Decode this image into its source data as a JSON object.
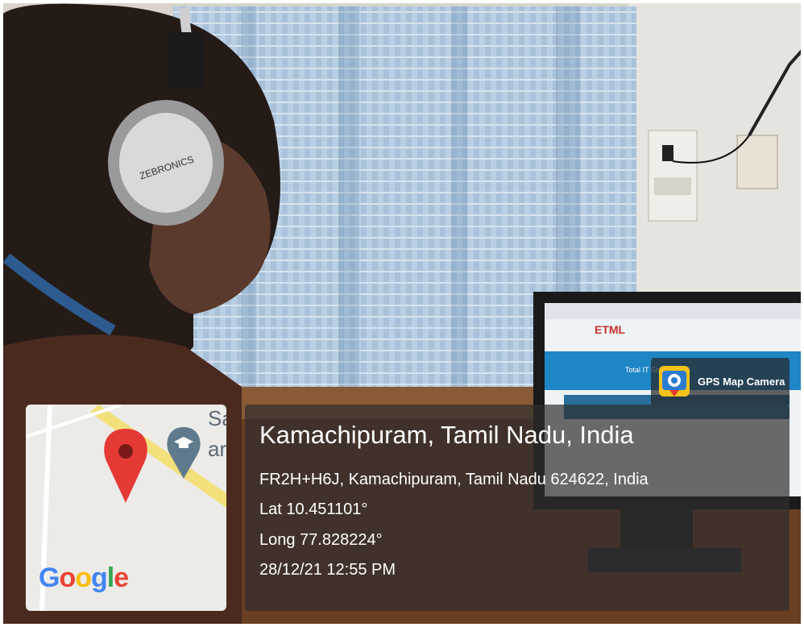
{
  "overlay": {
    "place_title": "Kamachipuram, Tamil Nadu, India",
    "address": "FR2H+H6J, Kamachipuram, Tamil Nadu 624622, India",
    "latitude": "Lat 10.451101°",
    "longitude": "Long 77.828224°",
    "timestamp": "28/12/21 12:55 PM"
  },
  "badge": {
    "app_name": "GPS Map Camera",
    "icon": "gps-camera-icon"
  },
  "map": {
    "place_fragment_1": "Sa",
    "place_fragment_2": "ar",
    "attribution": "Google",
    "pin_icon": "map-pin-icon",
    "poi_icon": "graduation-cap-icon",
    "colors": {
      "pin": "#e53935",
      "poi": "#5f7a8c",
      "road": "#f3e07a"
    }
  },
  "scene_text": {
    "headphone_brand": "ZEBRONICS",
    "screen_logo": "ETML",
    "screen_banner": "Total IT Sol"
  }
}
